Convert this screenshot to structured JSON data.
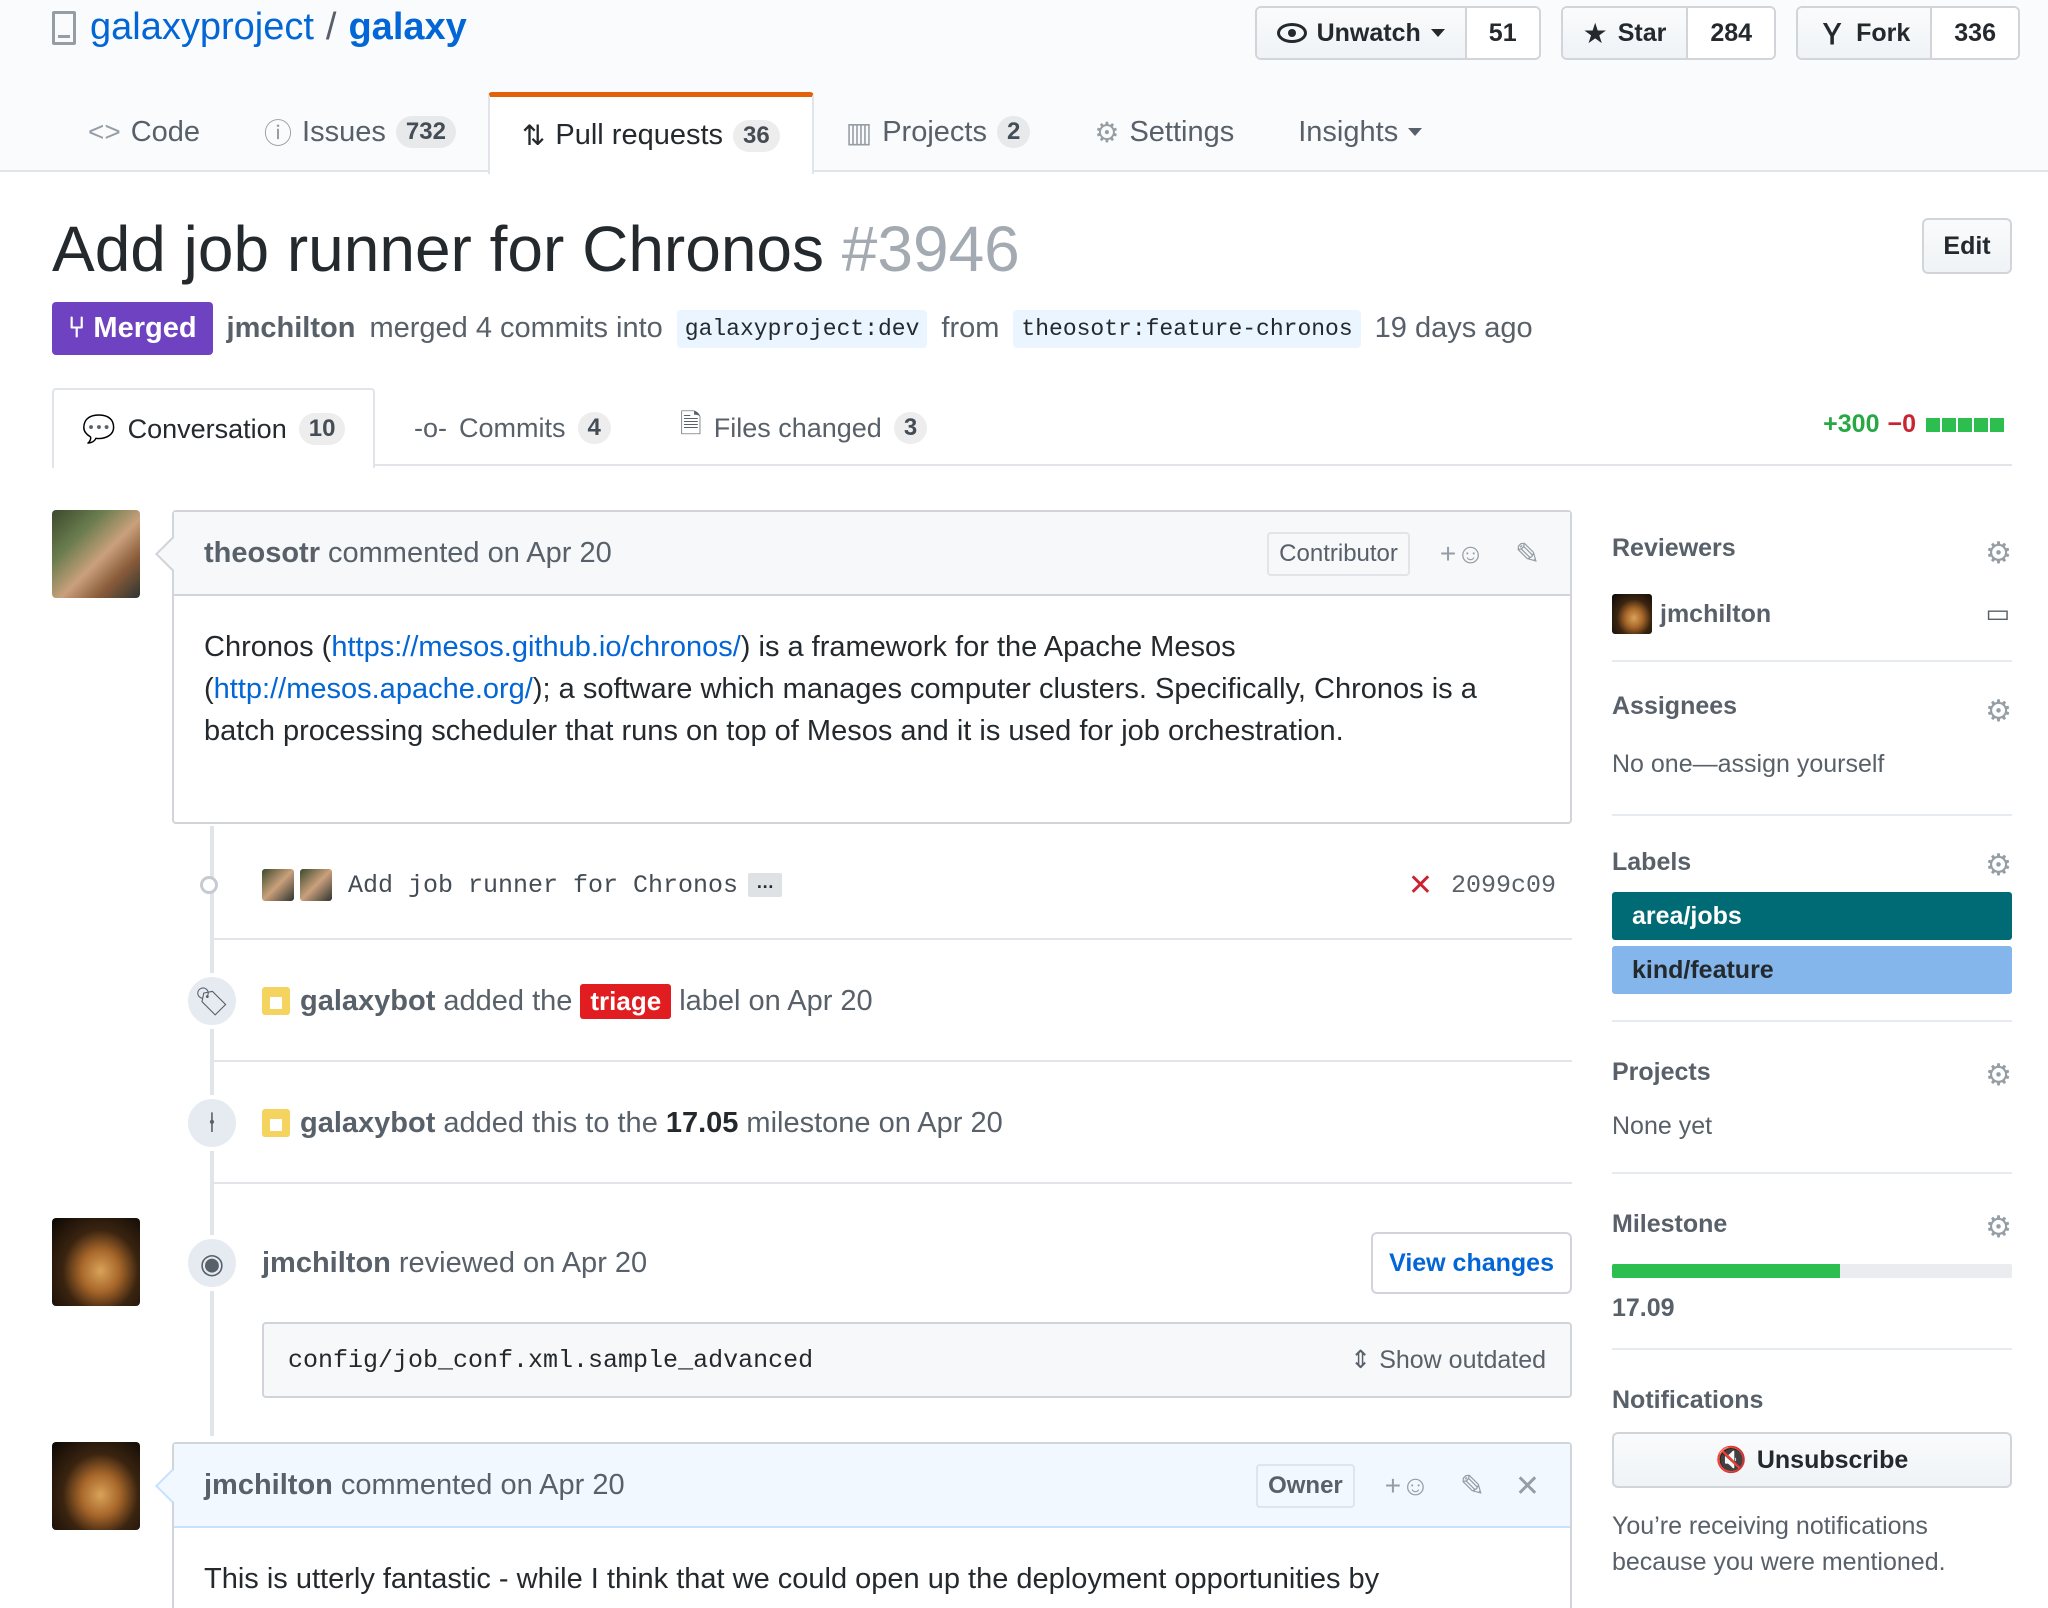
{
  "repo": {
    "owner": "galaxyproject",
    "separator": "/",
    "name": "galaxy"
  },
  "actions": {
    "watch": {
      "label": "Unwatch",
      "count": "51"
    },
    "star": {
      "label": "Star",
      "count": "284"
    },
    "fork": {
      "label": "Fork",
      "count": "336"
    }
  },
  "nav": [
    {
      "label": "Code",
      "icon": "code-icon",
      "glyph": "<>"
    },
    {
      "label": "Issues",
      "icon": "issue-icon",
      "glyph": "ⓘ",
      "count": "732"
    },
    {
      "label": "Pull requests",
      "icon": "pull-request-icon",
      "glyph": "⇅",
      "count": "36"
    },
    {
      "label": "Projects",
      "icon": "project-icon",
      "glyph": "▥",
      "count": "2"
    },
    {
      "label": "Settings",
      "icon": "gear-icon",
      "glyph": "⚙"
    },
    {
      "label": "Insights",
      "icon": "chevron-down-icon"
    }
  ],
  "pr": {
    "title": "Add job runner for Chronos",
    "number": "#3946",
    "edit_label": "Edit",
    "state": "Merged",
    "author": "jmchilton",
    "merge_text": "merged 4 commits into",
    "base_branch": "galaxyproject:dev",
    "from_text": "from",
    "head_branch": "theosotr:feature-chronos",
    "age": "19 days ago"
  },
  "tabs": [
    {
      "label": "Conversation",
      "count": "10"
    },
    {
      "label": "Commits",
      "count": "4"
    },
    {
      "label": "Files changed",
      "count": "3"
    }
  ],
  "diffstat": {
    "additions": "+300",
    "deletions": "−0"
  },
  "comment1": {
    "author": "theosotr",
    "action": "commented on Apr 20",
    "role": "Contributor",
    "text_a": "Chronos (",
    "link1": "https://mesos.github.io/chronos/",
    "text_b": ") is a framework for the Apache Mesos (",
    "link2": "http://mesos.apache.org/",
    "text_c": "); a software which manages computer clusters. Specifically, Chronos is a batch processing scheduler that runs on top of Mesos and it is used for job orchestration."
  },
  "commit": {
    "message": "Add job runner for Chronos",
    "ellipsis": "…",
    "sha": "2099c09"
  },
  "label_event": {
    "actor": "galaxybot",
    "text_before": "added the",
    "label": "triage",
    "text_after": "label on Apr 20"
  },
  "milestone_event": {
    "actor": "galaxybot",
    "text_before": "added this to the",
    "milestone": "17.05",
    "text_after": "milestone on Apr 20"
  },
  "review": {
    "author": "jmchilton",
    "action": "reviewed on Apr 20",
    "button": "View changes",
    "file": "config/job_conf.xml.sample_advanced",
    "outdated": "Show outdated"
  },
  "comment2": {
    "author": "jmchilton",
    "action": "commented on Apr 20",
    "role": "Owner",
    "text": "This is utterly fantastic - while I think that we could open up the deployment opportunities by"
  },
  "sidebar": {
    "reviewers": {
      "heading": "Reviewers",
      "user": "jmchilton"
    },
    "assignees": {
      "heading": "Assignees",
      "text": "No one—assign yourself"
    },
    "labels": {
      "heading": "Labels",
      "items": [
        {
          "name": "area/jobs",
          "color": "#006b75",
          "text_color": "#ffffff"
        },
        {
          "name": "kind/feature",
          "color": "#84b6eb",
          "text_color": "#24292e"
        }
      ]
    },
    "projects": {
      "heading": "Projects",
      "text": "None yet"
    },
    "milestone": {
      "heading": "Milestone",
      "name": "17.09",
      "progress": 0.57
    },
    "notifications": {
      "heading": "Notifications",
      "button": "Unsubscribe",
      "reason": "You’re receiving notifications because you were mentioned."
    }
  }
}
